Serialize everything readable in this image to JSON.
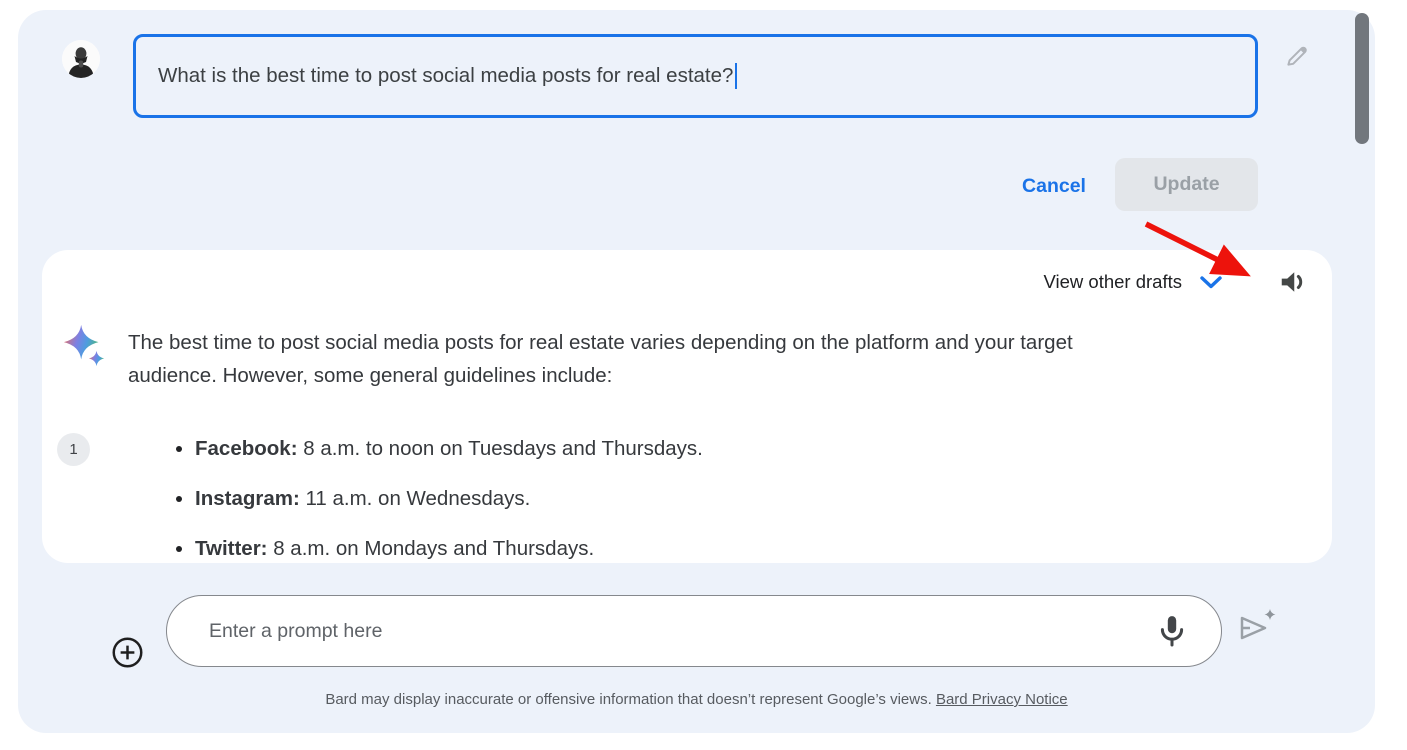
{
  "edit": {
    "prompt_text": "What is the best time to post social media posts for real estate?",
    "cancel_label": "Cancel",
    "update_label": "Update"
  },
  "response": {
    "view_other_drafts_label": "View other drafts",
    "draft_badge": "1",
    "paragraph_lines": [
      "The best time to post social media posts for real estate varies depending on the platform and your target",
      "audience. However, some general guidelines include:"
    ],
    "bullets": [
      {
        "platform": "Facebook:",
        "detail": " 8 a.m. to noon on Tuesdays and Thursdays."
      },
      {
        "platform": "Instagram:",
        "detail": " 11 a.m. on Wednesdays."
      },
      {
        "platform": "Twitter:",
        "detail": " 8 a.m. on Mondays and Thursdays."
      }
    ]
  },
  "composer": {
    "placeholder": "Enter a prompt here"
  },
  "footer": {
    "disclaimer": "Bard may display inaccurate or offensive information that doesn’t represent Google’s views. ",
    "privacy_link": "Bard Privacy Notice"
  },
  "icons": {
    "edit_pencil": "pencil-outline",
    "drafts_expand": "chevron-down",
    "tts": "volume-up-speaker",
    "bard_logo": "four-point-sparkle",
    "add_attachment": "circled-plus",
    "voice_input": "microphone",
    "send": "paper-plane-with-sparkle",
    "annotation": "red-arrow"
  },
  "colors": {
    "accent_blue": "#1a73e8",
    "arrow_red": "#ed130c",
    "panel_bg": "#edf2fa",
    "card_bg": "#ffffff",
    "disabled_button_bg": "#e3e6ea",
    "disabled_button_text": "#9aa0a6",
    "text_primary": "#3c4043",
    "text_secondary": "#5f6368",
    "scrollbar_thumb": "#72777d",
    "badge_bg": "#e9ebee"
  }
}
